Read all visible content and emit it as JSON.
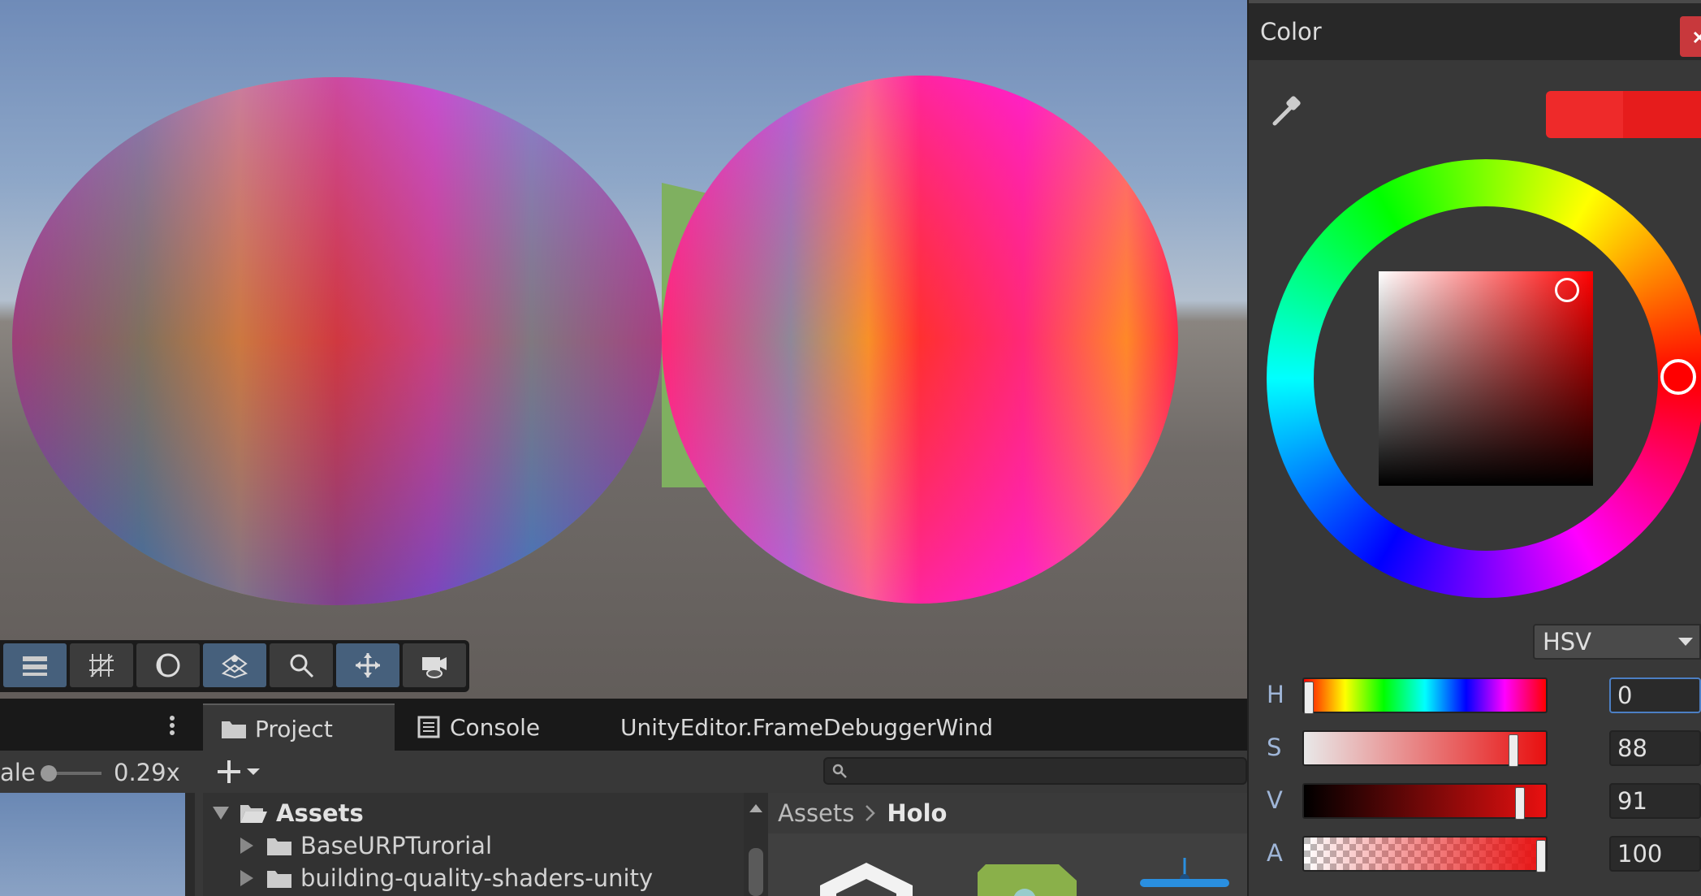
{
  "scene_toolbar": {
    "buttons": [
      {
        "name": "layers-icon",
        "active": true
      },
      {
        "name": "grid-icon",
        "active": false
      },
      {
        "name": "lighting-icon",
        "active": false
      },
      {
        "name": "gizmos-icon",
        "active": true
      },
      {
        "name": "search-icon",
        "active": false
      },
      {
        "name": "move-tool-icon",
        "active": true
      },
      {
        "name": "camera-visibility-icon",
        "active": false
      }
    ]
  },
  "bottom_tabs": {
    "project": "Project",
    "console": "Console",
    "frame_debugger": "UnityEditor.FrameDebuggerWind"
  },
  "left_panel": {
    "scale_label": "ale",
    "scale_value": "0.29x"
  },
  "project": {
    "tree": {
      "root": "Assets",
      "items": [
        "BaseURPTurorial",
        "building-quality-shaders-unity"
      ]
    },
    "breadcrumb": {
      "root": "Assets",
      "current": "Holo"
    }
  },
  "color_window": {
    "title": "Color",
    "current_color": "#ee2a2a",
    "previous_color": "#e61c1c",
    "mode": "HSV",
    "channels": [
      {
        "label": "H",
        "value": "0",
        "level": 0
      },
      {
        "label": "S",
        "value": "88",
        "level": 0.88
      },
      {
        "label": "V",
        "value": "91",
        "level": 0.91
      },
      {
        "label": "A",
        "value": "100",
        "level": 1.0
      }
    ]
  }
}
